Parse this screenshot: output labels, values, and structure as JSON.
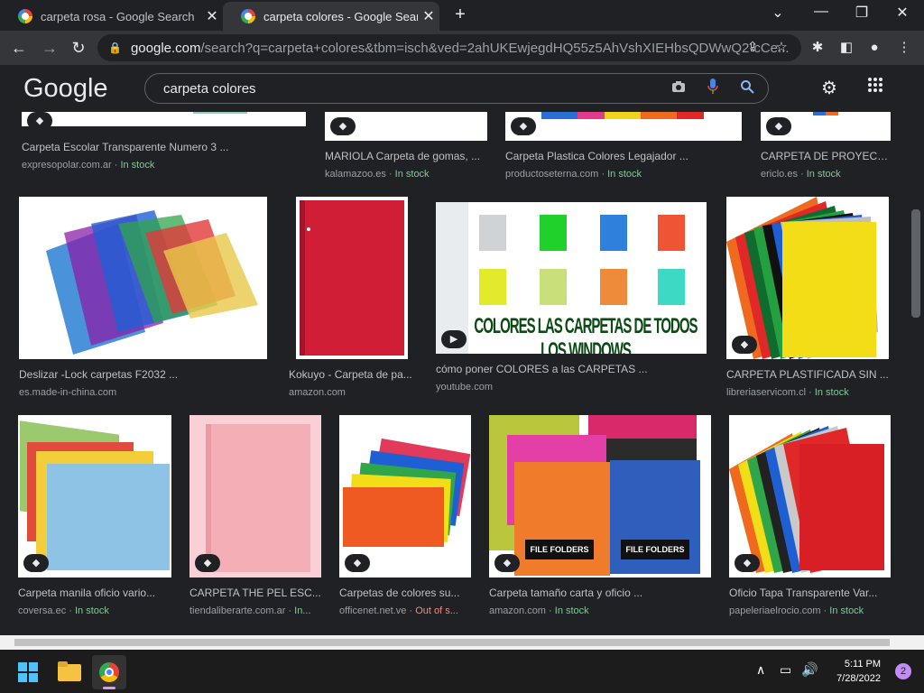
{
  "tabs": [
    {
      "title": "carpeta rosa - Google Search",
      "state": "inactive"
    },
    {
      "title": "carpeta colores - Google Search",
      "state": "active"
    }
  ],
  "address": {
    "host": "google.com",
    "path": "/search?q=carpeta+colores&tbm=isch&ved=2ahUKEwjegdHQ55z5AhVshXIEHbsQDWwQ2-cCe..."
  },
  "search": {
    "logo": "Google",
    "query": "carpeta colores"
  },
  "row0": [
    {
      "title": "Carpeta Escolar Transparente Numero 3 ...",
      "source": "expresopolar.com.ar",
      "status": "In stock"
    },
    {
      "title": "MARIOLA Carpeta de gomas, ...",
      "source": "kalamazoo.es",
      "status": "In stock"
    },
    {
      "title": "Carpeta Plastica Colores Legajador ...",
      "source": "productoseterna.com",
      "status": "In stock"
    },
    {
      "title": "CARPETA DE PROYECT...",
      "source": "ericlo.es",
      "status": "In stock"
    }
  ],
  "row1": [
    {
      "title": "Deslizar -Lock carpetas F2032 ...",
      "source": "es.made-in-china.com",
      "status": ""
    },
    {
      "title": "Kokuyo - Carpeta de pa...",
      "source": "amazon.com",
      "status": ""
    },
    {
      "title": "cómo poner COLORES a las CARPETAS ...",
      "source": "youtube.com",
      "status": "",
      "overlay": "COLORES LAS CARPETAS DE TODOS LOS WINDOWS"
    },
    {
      "title": "CARPETA PLASTIFICADA SIN ...",
      "source": "libreriaservicom.cl",
      "status": "In stock"
    }
  ],
  "row2": [
    {
      "title": "Carpeta manila oficio vario...",
      "source": "coversa.ec",
      "status": "In stock"
    },
    {
      "title": "CARPETA THE PEL ESC...",
      "source": "tiendaliberarte.com.ar",
      "status": "In..."
    },
    {
      "title": "Carpetas de colores su...",
      "source": "officenet.net.ve",
      "status": "Out of s..."
    },
    {
      "title": "Carpeta tamaño carta y oficio ...",
      "source": "amazon.com",
      "status": "In stock",
      "overlay": "FILE FOLDERS"
    },
    {
      "title": "Oficio Tapa Transparente Var...",
      "source": "papeleriaelrocio.com",
      "status": "In stock"
    }
  ],
  "clock": {
    "time": "5:11 PM",
    "date": "7/28/2022"
  },
  "notifications": "2",
  "colors": {
    "bg": "#202124",
    "stock": "#81c995",
    "out_of_stock": "#f28b82",
    "accent": "#8ab4f8"
  }
}
